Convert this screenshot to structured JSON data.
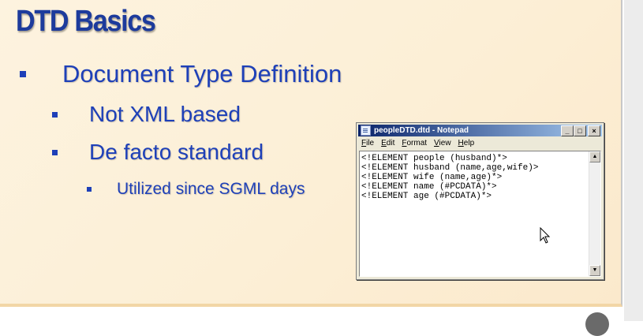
{
  "slide": {
    "title": "DTD Basics",
    "bullets": {
      "level1": "Document Type Definition",
      "level2_a": "Not XML based",
      "level2_b": "De facto standard",
      "level3": "Utilized since SGML days"
    }
  },
  "notepad": {
    "title": "peopleDTD.dtd - Notepad",
    "window_buttons": {
      "minimize": "_",
      "maximize": "□",
      "close": "×"
    },
    "menu": [
      "File",
      "Edit",
      "Format",
      "View",
      "Help"
    ],
    "content_lines": [
      "<!ELEMENT people (husband)*>",
      "<!ELEMENT husband (name,age,wife)>",
      "<!ELEMENT wife (name,age)*>",
      "<!ELEMENT name (#PCDATA)*>",
      "<!ELEMENT age (#PCDATA)*>"
    ]
  },
  "colors": {
    "title": "#1d3b9c",
    "bullet_text": "#1e40b8",
    "slide_bg": "#fdf3df"
  },
  "icons": [
    "notepad-app-icon",
    "mouse-pointer-icon"
  ]
}
